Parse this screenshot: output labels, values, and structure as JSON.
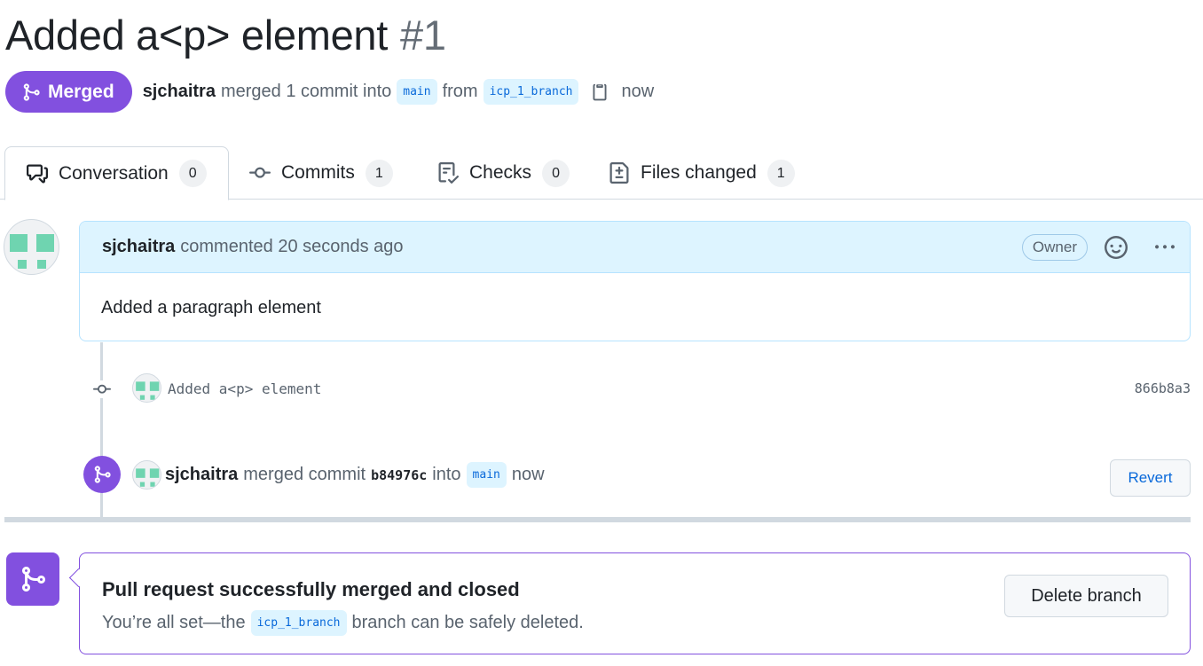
{
  "pr": {
    "title": "Added a<p> element",
    "number": "#1",
    "state_label": "Merged",
    "author": "sjchaitra",
    "merged_text": "merged 1 commit into",
    "base_branch": "main",
    "from_text": "from",
    "head_branch": "icp_1_branch",
    "time": "now"
  },
  "tabs": [
    {
      "label": "Conversation",
      "count": "0"
    },
    {
      "label": "Commits",
      "count": "1"
    },
    {
      "label": "Checks",
      "count": "0"
    },
    {
      "label": "Files changed",
      "count": "1"
    }
  ],
  "comment": {
    "author": "sjchaitra",
    "meta": "commented 20 seconds ago",
    "role": "Owner",
    "body": "Added a paragraph element"
  },
  "commit": {
    "message": "Added a<p> element",
    "sha": "866b8a3"
  },
  "merge_event": {
    "author": "sjchaitra",
    "text": "merged commit",
    "sha": "b84976c",
    "into_text": "into",
    "branch": "main",
    "time": "now",
    "revert_label": "Revert"
  },
  "merge_box": {
    "title": "Pull request successfully merged and closed",
    "sub_before": "You’re all set—the",
    "branch": "icp_1_branch",
    "sub_after": "branch can be safely deleted.",
    "delete_label": "Delete branch"
  },
  "colors": {
    "merged_purple": "#8250df",
    "link_blue": "#0969da",
    "comment_header_bg": "#ddf4ff",
    "identicon_green": "#6fd4b0"
  },
  "icons": [
    "git-merge-icon",
    "copy-icon",
    "comment-discussion-icon",
    "git-commit-icon",
    "checklist-icon",
    "file-diff-icon",
    "smiley-icon",
    "kebab-horizontal-icon"
  ]
}
